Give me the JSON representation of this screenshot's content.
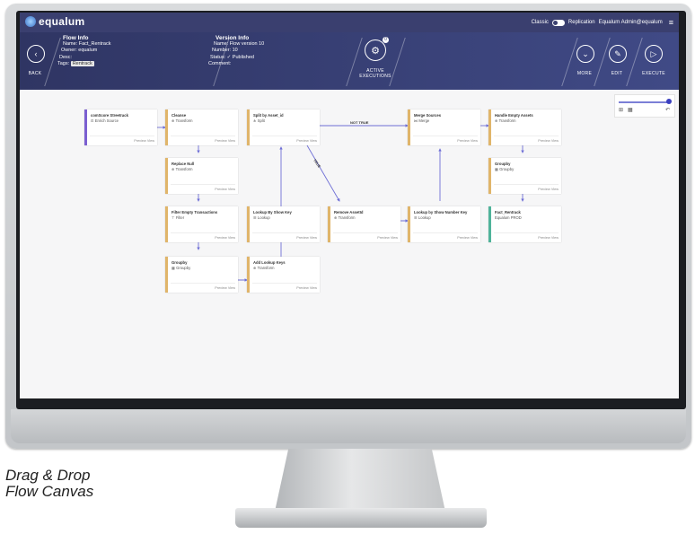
{
  "app": {
    "logo": "equalum"
  },
  "topbar": {
    "classic": "Classic",
    "replication": "Replication",
    "user": "Equalum Admin@equalum",
    "menu_icon": "≡"
  },
  "back": {
    "label": "BACK",
    "icon": "‹"
  },
  "flow_info": {
    "heading": "Flow Info",
    "name": "Name: Fact_Rentrack",
    "owner": "Owner: equalum",
    "desc": "Desc:",
    "tags_label": "Tags:",
    "tag": "Rentrack"
  },
  "version_info": {
    "heading": "Version Info",
    "name": "Name: Flow version 10",
    "number": "Number: 10",
    "status_label": "Status:",
    "status": "Published",
    "comment": "Comment:"
  },
  "active_executions": {
    "label_line1": "ACTIVE",
    "label_line2": "EXECUTIONS",
    "badge": "0"
  },
  "actions": {
    "more": "MORE",
    "edit": "EDIT",
    "execute": "EXECUTE"
  },
  "nodes": [
    {
      "title": "comScore Streetrack",
      "subtitle": "Enrich Source",
      "actions": "Preview  View"
    },
    {
      "title": "Cleanse",
      "subtitle": "Transform",
      "actions": "Preview  View"
    },
    {
      "title": "Replace Null",
      "subtitle": "Transform",
      "actions": "Preview  View"
    },
    {
      "title": "Filter Empty Transactions",
      "subtitle": "Filter",
      "actions": "Preview  View"
    },
    {
      "title": "Groupby",
      "subtitle": "Groupby",
      "actions": "Preview  View"
    },
    {
      "title": "Split by Asset_id",
      "subtitle": "Split",
      "actions": "Preview  View"
    },
    {
      "title": "Lookup By Show Key",
      "subtitle": "Lookup",
      "actions": "Preview  View"
    },
    {
      "title": "Add Lookup Keys",
      "subtitle": "Transform",
      "actions": "Preview  View"
    },
    {
      "title": "Remove AssetId",
      "subtitle": "Transform",
      "actions": "Preview  View"
    },
    {
      "title": "Merge Sources",
      "subtitle": "Merge",
      "actions": "Preview  View"
    },
    {
      "title": "Lookup by Show Number Key",
      "subtitle": "Lookup",
      "actions": "Preview  View"
    },
    {
      "title": "Handle Empty Assets",
      "subtitle": "Transform",
      "actions": "Preview  View"
    },
    {
      "title": "Groupby",
      "subtitle": "Groupby",
      "actions": "Preview  View"
    },
    {
      "title": "Fact_Rentrack",
      "subtitle": "Equalum PROD",
      "actions": "Preview  View"
    }
  ],
  "edges": {
    "not_true": "NOT TRUE",
    "true": "TRUE"
  },
  "caption": {
    "line1": "Drag & Drop",
    "line2": "Flow Canvas"
  },
  "colors": {
    "header": "#3a3f6f",
    "node_border": "#e0b56a",
    "source_border": "#7b5fd1",
    "target_border": "#4fb39a",
    "edge": "#6f6fd6"
  }
}
